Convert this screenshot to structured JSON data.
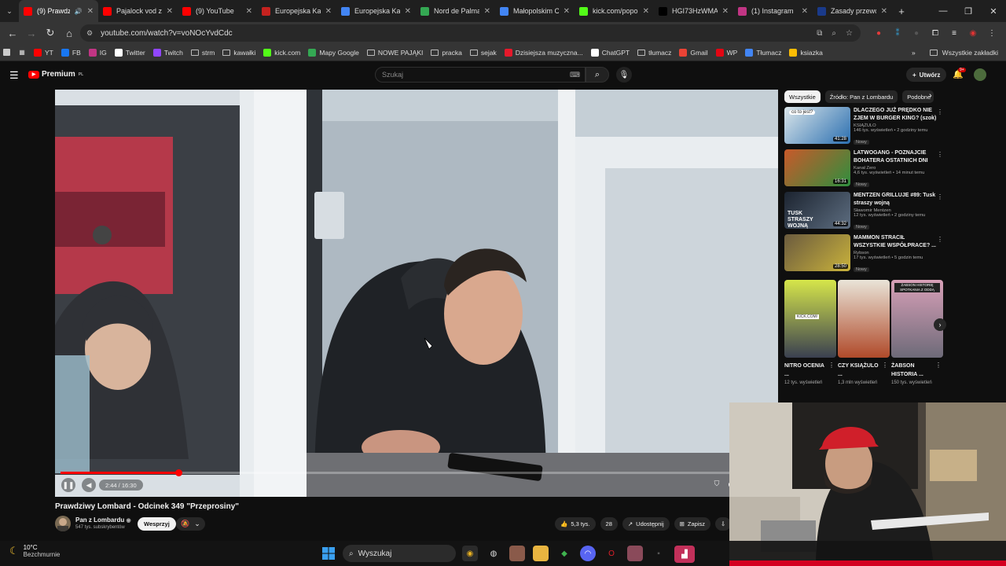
{
  "browser": {
    "tabs": [
      {
        "title": "(9) Prawdz",
        "icon": "youtube-icon",
        "active": true,
        "color": "#ff0000"
      },
      {
        "title": "Pajalock vod z",
        "icon": "youtube-icon",
        "color": "#ff0000"
      },
      {
        "title": "(9) YouTube",
        "icon": "youtube-icon",
        "color": "#ff0000"
      },
      {
        "title": "Europejska Kar",
        "icon": "gmail-icon",
        "color": "#c5221f"
      },
      {
        "title": "Europejska Kar",
        "icon": "google-icon",
        "color": "#4285f4"
      },
      {
        "title": "Nord de Palma",
        "icon": "maps-icon",
        "color": "#34a853"
      },
      {
        "title": "Małopolskim C",
        "icon": "google-icon",
        "color": "#4285f4"
      },
      {
        "title": "kick.com/popo",
        "icon": "kick-icon",
        "color": "#53fc18"
      },
      {
        "title": "HGI73HzWMA",
        "icon": "x-icon",
        "color": "#000000"
      },
      {
        "title": "(1) Instagram",
        "icon": "instagram-icon",
        "color": "#c13584"
      },
      {
        "title": "Zasady przewo",
        "icon": "shield-icon",
        "color": "#1a3a8a"
      }
    ],
    "url": "youtube.com/watch?v=voNOcYvdCdc",
    "bookmarks": [
      {
        "label": "YT",
        "icon": "youtube-icon",
        "color": "#ff0000"
      },
      {
        "label": "FB",
        "icon": "facebook-icon",
        "color": "#1877f2"
      },
      {
        "label": "IG",
        "icon": "instagram-icon",
        "color": "#c13584"
      },
      {
        "label": "Twitter",
        "icon": "x-icon",
        "color": "#ffffff"
      },
      {
        "label": "Twitch",
        "icon": "twitch-icon",
        "color": "#9146ff"
      },
      {
        "label": "strm",
        "icon": "folder-icon",
        "color": "#bbbbbb"
      },
      {
        "label": "kawałki",
        "icon": "folder-icon",
        "color": "#bbbbbb"
      },
      {
        "label": "kick.com",
        "icon": "kick-icon",
        "color": "#53fc18"
      },
      {
        "label": "Mapy Google",
        "icon": "maps-icon",
        "color": "#34a853"
      },
      {
        "label": "NOWE PAJĄKI",
        "icon": "folder-icon",
        "color": "#bbbbbb"
      },
      {
        "label": "pracka",
        "icon": "folder-icon",
        "color": "#bbbbbb"
      },
      {
        "label": "sejak",
        "icon": "folder-icon",
        "color": "#bbbbbb"
      },
      {
        "label": "Dzisiejsza muzyczna...",
        "icon": "music-icon",
        "color": "#e6192b"
      },
      {
        "label": "ChatGPT",
        "icon": "chatgpt-icon",
        "color": "#ffffff"
      },
      {
        "label": "tłumacz",
        "icon": "folder-icon",
        "color": "#bbbbbb"
      },
      {
        "label": "Gmail",
        "icon": "gmail-icon",
        "color": "#ea4335"
      },
      {
        "label": "WP",
        "icon": "wp-icon",
        "color": "#e30613"
      },
      {
        "label": "Tłumacz",
        "icon": "translate-icon",
        "color": "#4285f4"
      },
      {
        "label": "ksiazka",
        "icon": "apps-icon",
        "color": "#fbbc04"
      }
    ],
    "all_bookmarks": "Wszystkie zakładki"
  },
  "youtube": {
    "logo": "Premium",
    "logo_country": "PL",
    "search_placeholder": "Szukaj",
    "create_label": "Utwórz",
    "notif_count": "9+",
    "accent": "#ff0000"
  },
  "player": {
    "time": "2:44 / 16:30",
    "progress": 0.166
  },
  "video": {
    "title": "Prawdziwy Lombard - Odcinek 349 \"Przeprosiny\"",
    "channel": "Pan z Lombardu",
    "subscribers": "547 tys. subskrybentów",
    "support": "Wesprzyj",
    "likes": "5,3 tys.",
    "comments": "28",
    "share": "Udostępnij",
    "save": "Zapisz"
  },
  "sidebar": {
    "chips": [
      "Wszystkie",
      "Źródło: Pan z Lombardu",
      "Podobne"
    ],
    "videos": [
      {
        "title": "DLACZEGO JUŻ PRĘDKO NIE ZJEM W BURGER KING? (szok)",
        "channel": "KSIĄŻULO",
        "meta": "146 tys. wyświetleń • 2 godziny temu",
        "badge": "Nowy",
        "duration": "41:28",
        "colors": [
          "#dbe6ea",
          "#2b6fb0"
        ]
      },
      {
        "title": "LATWOGANG - POZNAJCIE BOHATERA OSTATNICH DNI",
        "channel": "Kanał Zero",
        "meta": "4,6 tys. wyświetleń • 14 minut temu",
        "badge": "Nowy",
        "duration": "16:31",
        "colors": [
          "#c9592a",
          "#2e8f3e"
        ]
      },
      {
        "title": "MENTZEN GRILLUJE #89: Tusk straszy wojną",
        "channel": "Sławomir Mentzen",
        "meta": "12 tys. wyświetleń • 2 godziny temu",
        "badge": "Nowy",
        "duration": "44:32",
        "colors": [
          "#1c2430",
          "#5d6d80"
        ]
      },
      {
        "title": "MAMMON STRACIŁ WSZYSTKIE WSPÓŁPRACE? ...",
        "channel": "Rybson",
        "meta": "17 tys. wyświetleń • 5 godzin temu",
        "badge": "Nowy",
        "duration": "28:50",
        "colors": [
          "#6b5b3e",
          "#c9b23c"
        ]
      }
    ],
    "shorts": [
      {
        "title": "NITRO OCENIA ...",
        "views": "12 tys. wyświetleń",
        "colors": [
          "#d6e64a",
          "#3a4050"
        ]
      },
      {
        "title": "CZY KSIĄŻULO ...",
        "views": "1,3 mln wyświetleń",
        "colors": [
          "#e9e4d8",
          "#b04a2a"
        ]
      },
      {
        "title": "ŻABSON HISTORIA ...",
        "views": "150 tys. wyświetleń",
        "colors": [
          "#d8a0b8",
          "#6d6a78"
        ]
      }
    ],
    "thumb_texts": [
      "co to jest?",
      "TUSK STRASZY WOJNĄ",
      "KICK.COM/",
      "ŻABSON HISTORIĘ SPOTKANIA Z ODDĄ"
    ]
  },
  "taskbar": {
    "temp": "10°C",
    "weather": "Bezchmurnie",
    "search": "Wyszukaj"
  }
}
